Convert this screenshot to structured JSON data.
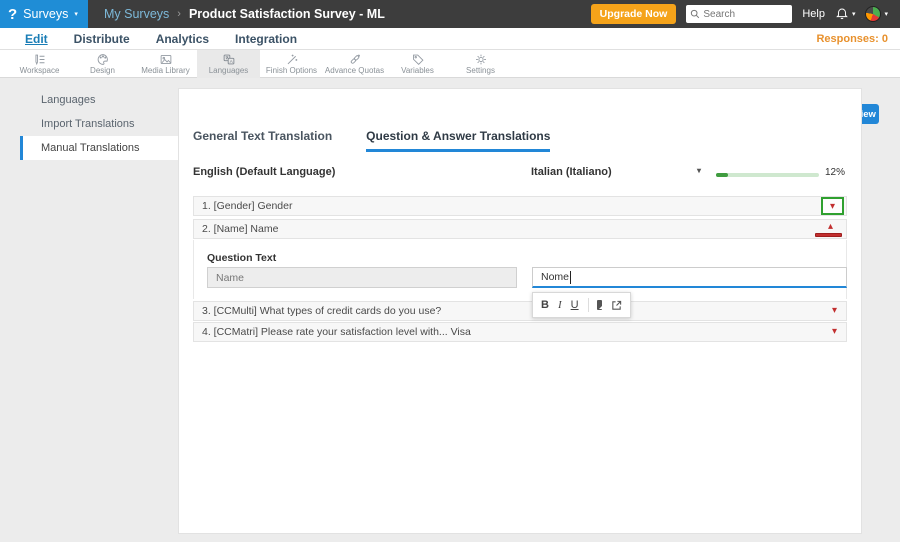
{
  "topbar": {
    "logo_glyph": "?",
    "product_menu": "Surveys",
    "breadcrumb": {
      "parent": "My Surveys",
      "separator": "›",
      "current": "Product Satisfaction Survey - ML"
    },
    "upgrade_label": "Upgrade Now",
    "search_placeholder": "Search",
    "help_label": "Help"
  },
  "nav": {
    "items": [
      {
        "label": "Edit",
        "active": true
      },
      {
        "label": "Distribute",
        "active": false
      },
      {
        "label": "Analytics",
        "active": false
      },
      {
        "label": "Integration",
        "active": false
      }
    ],
    "responses_label": "Responses: 0"
  },
  "toolbar": {
    "items": [
      {
        "label": "Workspace",
        "icon": "workspace-icon"
      },
      {
        "label": "Design",
        "icon": "design-icon"
      },
      {
        "label": "Media Library",
        "icon": "media-library-icon"
      },
      {
        "label": "Languages",
        "icon": "languages-icon",
        "selected": true
      },
      {
        "label": "Finish Options",
        "icon": "finish-options-icon"
      },
      {
        "label": "Advance Quotas",
        "icon": "advance-quotas-icon"
      },
      {
        "label": "Variables",
        "icon": "variables-icon"
      },
      {
        "label": "Settings",
        "icon": "settings-icon"
      }
    ],
    "url_value": "https://questionpro.com/t/AW22Zd1S1",
    "preview_label": "Preview"
  },
  "sidebar": {
    "items": [
      {
        "label": "Languages",
        "active": false
      },
      {
        "label": "Import Translations",
        "active": false
      },
      {
        "label": "Manual Translations",
        "active": true
      }
    ]
  },
  "main": {
    "tabs": [
      "General Text Translation",
      "Question & Answer Translations"
    ],
    "active_tab": "Question & Answer Translations",
    "source_language": "English (Default Language)",
    "target_language": "Italian (Italiano)",
    "progress_percent": "12%",
    "questions": [
      {
        "label": "1. [Gender] Gender",
        "state": "collapsed-annotated"
      },
      {
        "label": "2. [Name] Name",
        "state": "expanded"
      },
      {
        "label": "3. [CCMulti] What types of credit cards do you use?",
        "state": "collapsed"
      },
      {
        "label": "4. [CCMatri] Please rate your satisfaction level with... Visa",
        "state": "collapsed"
      }
    ],
    "editor": {
      "section_label": "Question Text",
      "source_value": "Name",
      "target_value": "Nome",
      "toolbar": {
        "bold": "B",
        "italic": "I",
        "underline": "U"
      }
    }
  },
  "colors": {
    "accent_blue": "#2287d7",
    "brand_blue": "#1f8dd6",
    "topbar_dark": "#3d3d3d",
    "upgrade_orange": "#f5a31a",
    "responses_orange": "#e8912d",
    "progress_green": "#3f9c3f",
    "caret_red": "#c22f2f",
    "annotation_green": "#2fa02f"
  }
}
